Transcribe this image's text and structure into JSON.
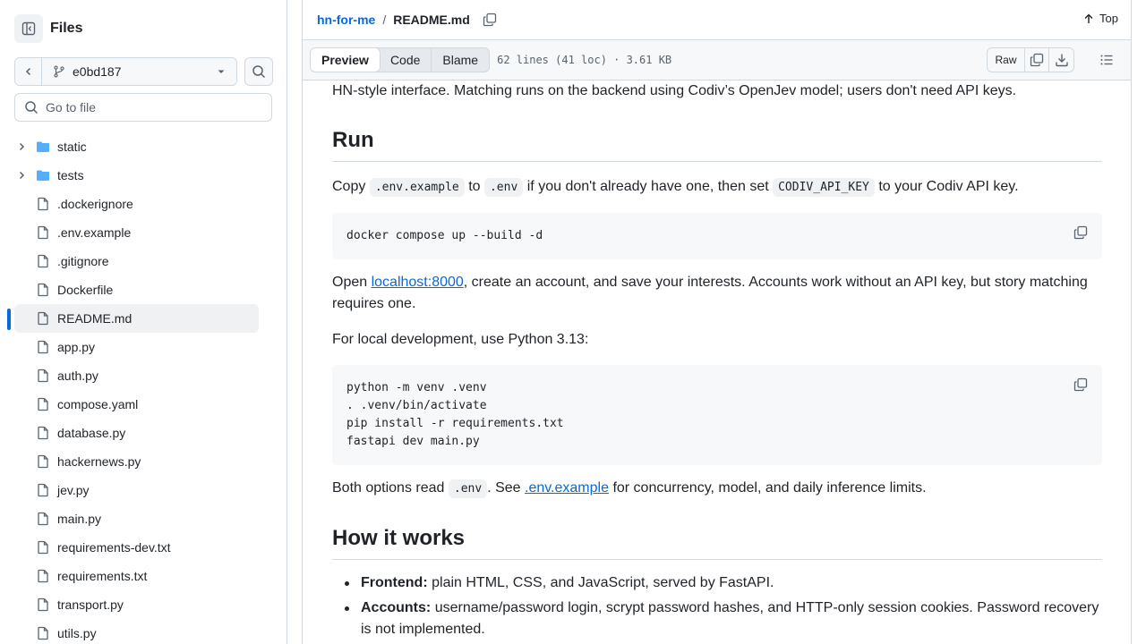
{
  "sidebar": {
    "title": "Files",
    "branch": "e0bd187",
    "search_placeholder": "Go to file",
    "items": [
      {
        "type": "folder",
        "label": "static"
      },
      {
        "type": "folder",
        "label": "tests"
      },
      {
        "type": "file",
        "label": ".dockerignore"
      },
      {
        "type": "file",
        "label": ".env.example"
      },
      {
        "type": "file",
        "label": ".gitignore"
      },
      {
        "type": "file",
        "label": "Dockerfile"
      },
      {
        "type": "file",
        "label": "README.md",
        "selected": true
      },
      {
        "type": "file",
        "label": "app.py"
      },
      {
        "type": "file",
        "label": "auth.py"
      },
      {
        "type": "file",
        "label": "compose.yaml"
      },
      {
        "type": "file",
        "label": "database.py"
      },
      {
        "type": "file",
        "label": "hackernews.py"
      },
      {
        "type": "file",
        "label": "jev.py"
      },
      {
        "type": "file",
        "label": "main.py"
      },
      {
        "type": "file",
        "label": "requirements-dev.txt"
      },
      {
        "type": "file",
        "label": "requirements.txt"
      },
      {
        "type": "file",
        "label": "transport.py"
      },
      {
        "type": "file",
        "label": "utils.py"
      }
    ]
  },
  "breadcrumb": {
    "repo": "hn-for-me",
    "sep": "/",
    "file": "README.md"
  },
  "top_label": "Top",
  "tabs": {
    "preview": "Preview",
    "code": "Code",
    "blame": "Blame"
  },
  "file_meta": "62 lines (41 loc) · 3.61 KB",
  "raw_label": "Raw",
  "readme": {
    "intro": "HN-style interface. Matching runs on the backend using Codiv’s OpenJev model; users don't need API keys.",
    "run_heading": "Run",
    "copy_1": "Copy",
    "env_example_code": ".env.example",
    "copy_2": "to",
    "env_code": ".env",
    "copy_3": "if you don't already have one, then set",
    "api_key_code": "CODIV_API_KEY",
    "copy_4": "to your Codiv API key.",
    "docker_cmd": "docker compose up --build -d",
    "open_1": "Open",
    "open_link": "localhost:8000",
    "open_2": ", create an account, and save your interests. Accounts work without an API key, but story matching requires one.",
    "local_dev": "For local development, use Python 3.13:",
    "local_cmds": "python -m venv .venv\n. .venv/bin/activate\npip install -r requirements.txt\nfastapi dev main.py",
    "both_1": "Both options read",
    "both_code": ".env",
    "both_2": ". See",
    "both_link": ".env.example",
    "both_3": "for concurrency, model, and daily inference limits.",
    "how_heading": "How it works",
    "bullets": [
      {
        "label": "Frontend:",
        "text": "plain HTML, CSS, and JavaScript, served by FastAPI."
      },
      {
        "label": "Accounts:",
        "text": "username/password login, scrypt password hashes, and HTTP-only session cookies. Password recovery is not implemented."
      }
    ]
  },
  "colors": {
    "accent": "#0969da",
    "border": "#d1d9e0",
    "muted": "#59636e",
    "folder": "#54aeff"
  }
}
